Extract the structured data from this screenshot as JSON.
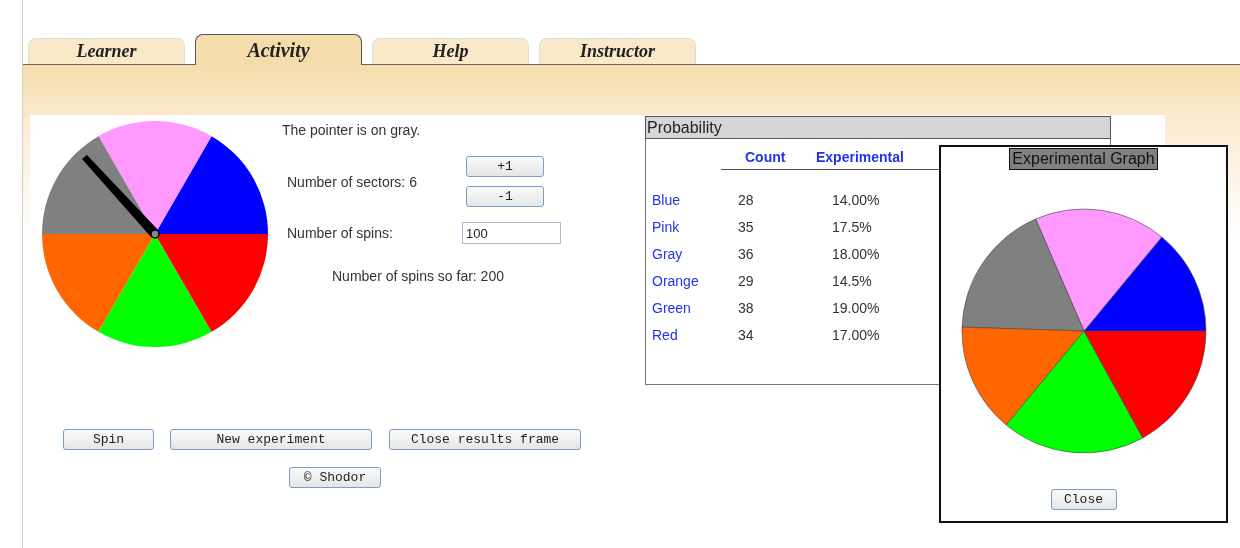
{
  "tabs": [
    {
      "label": "Learner",
      "selected": false
    },
    {
      "label": "Activity",
      "selected": true
    },
    {
      "label": "Help",
      "selected": false
    },
    {
      "label": "Instructor",
      "selected": false
    }
  ],
  "spinner": {
    "sectors": [
      {
        "color": "#0000ff"
      },
      {
        "color": "#ff99ff"
      },
      {
        "color": "#808080"
      },
      {
        "color": "#ff6600"
      },
      {
        "color": "#00ff00"
      },
      {
        "color": "#ff0000"
      }
    ]
  },
  "pointer_text": "The pointer is on gray.",
  "sectors_label": "Number of sectors: 6",
  "sector_buttons": [
    "+1",
    "-1"
  ],
  "spins_label": "Number of spins:",
  "spins_value": "100",
  "spins_so_far": "Number of spins so far: 200",
  "buttons": [
    "Spin",
    "New experiment",
    "Close results frame"
  ],
  "credit_button": "© Shodor",
  "probability": {
    "title": "Probability",
    "columns": [
      "Count",
      "Experimental"
    ],
    "rows": [
      {
        "name": "Blue",
        "count": "28",
        "experimental": "14.00%"
      },
      {
        "name": "Pink",
        "count": "35",
        "experimental": "17.5%"
      },
      {
        "name": "Gray",
        "count": "36",
        "experimental": "18.00%"
      },
      {
        "name": "Orange",
        "count": "29",
        "experimental": "14.5%"
      },
      {
        "name": "Green",
        "count": "38",
        "experimental": "19.00%"
      },
      {
        "name": "Red",
        "count": "34",
        "experimental": "17.00%"
      }
    ]
  },
  "graph_window": {
    "title": "Experimental Graph",
    "close_button": "Close"
  }
}
